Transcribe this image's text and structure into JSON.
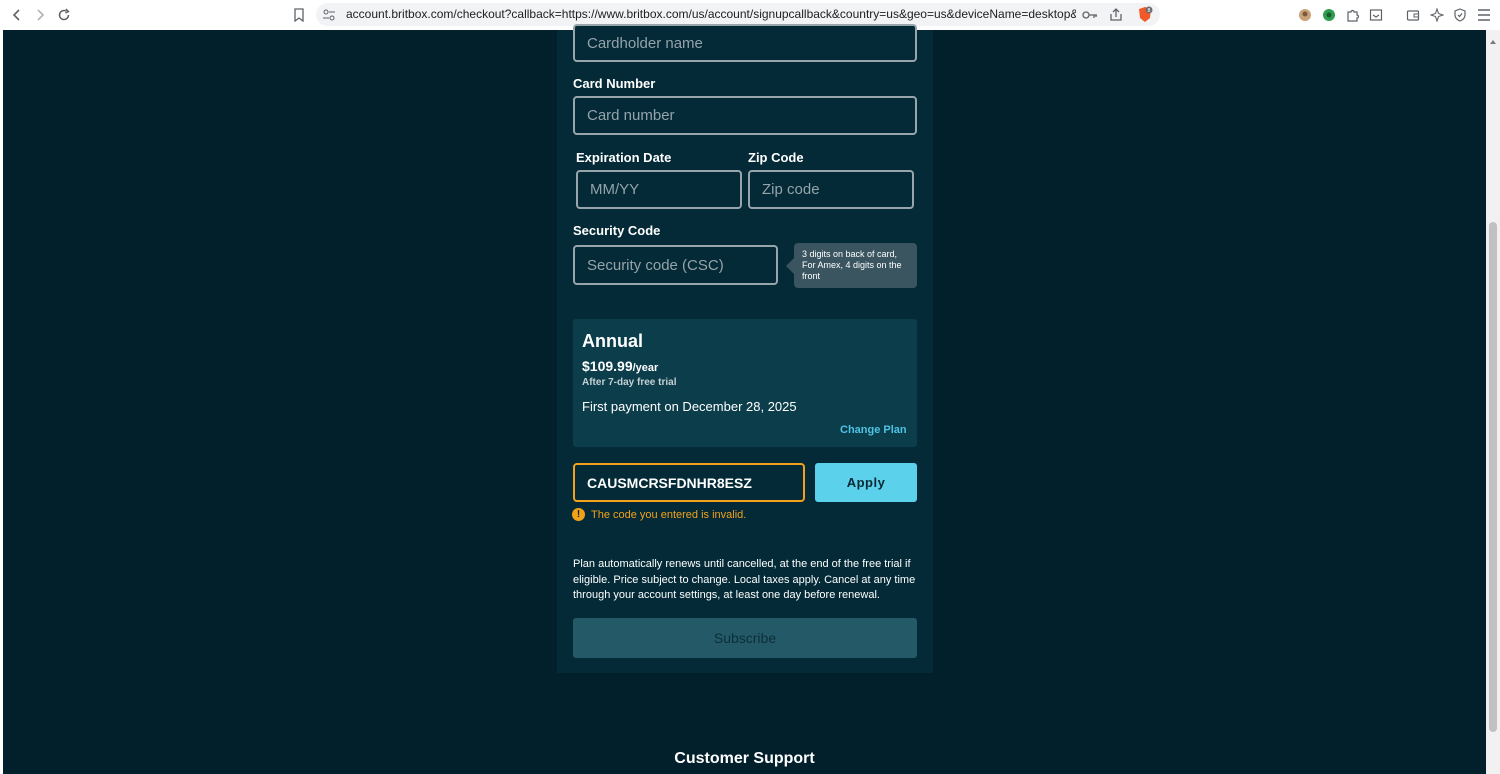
{
  "browser": {
    "url": "account.britbox.com/checkout?callback=https://www.britbox.com/us/account/signupcallback&country=us&geo=us&deviceName=desktop&deviceT...",
    "shield_badge": "8"
  },
  "form": {
    "cardholder_placeholder": "Cardholder name",
    "card_number_label": "Card Number",
    "card_number_placeholder": "Card number",
    "expiration_label": "Expiration Date",
    "expiration_placeholder": "MM/YY",
    "zip_label": "Zip Code",
    "zip_placeholder": "Zip code",
    "security_label": "Security Code",
    "security_placeholder": "Security code (CSC)",
    "security_tooltip": "3 digits on back of card, For Amex, 4 digits on the front"
  },
  "plan": {
    "name": "Annual",
    "price": "$109.99",
    "period": "/year",
    "trial": "After 7-day free trial",
    "first_payment": "First payment on December 28, 2025",
    "change_plan": "Change Plan"
  },
  "promo": {
    "code": "CAUSMCRSFDNHR8ESZ",
    "apply_label": "Apply",
    "error": "The code you entered is invalid.",
    "error_icon": "!"
  },
  "renewal_notice": "Plan automatically renews until cancelled, at the end of the free trial if eligible. Price subject to change. Local taxes apply. Cancel at any time through your account settings, at least one day before renewal.",
  "subscribe_label": "Subscribe",
  "support_title": "Customer Support",
  "colors": {
    "page_bg": "#01202b",
    "panel_bg": "#032a36",
    "accent": "#5bd1ec",
    "error": "#f3a11b"
  }
}
